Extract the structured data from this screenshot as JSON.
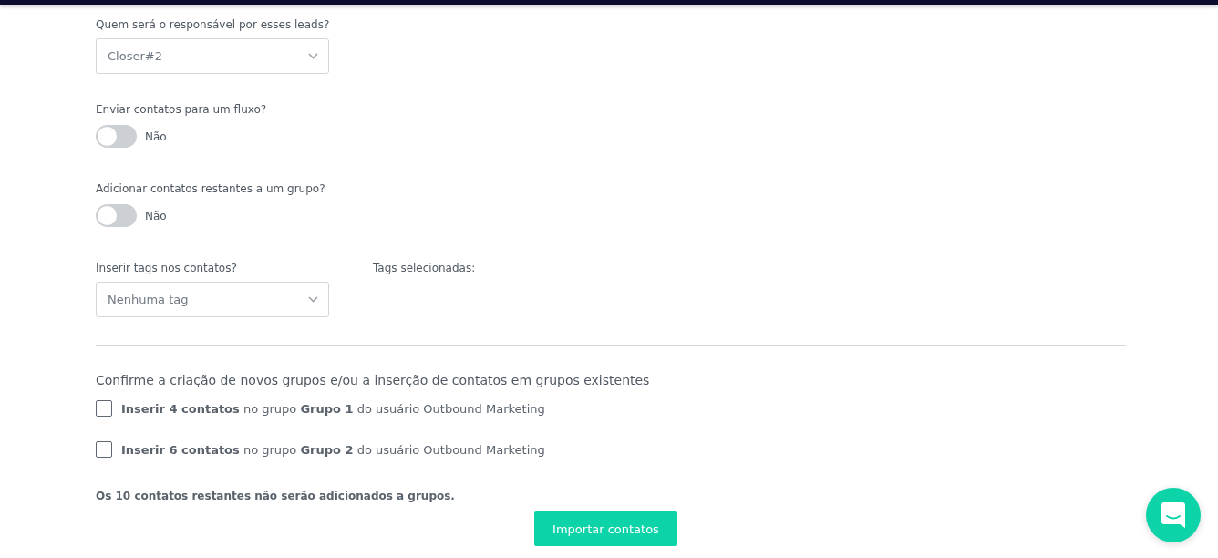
{
  "responsible": {
    "label": "Quem será o responsável por esses leads?",
    "value": "Closer#2"
  },
  "flow": {
    "label": "Enviar contatos para um fluxo?",
    "on": false,
    "state_label": "Não"
  },
  "group": {
    "label": "Adicionar contatos restantes a um grupo?",
    "on": false,
    "state_label": "Não"
  },
  "tags": {
    "label": "Inserir tags nos contatos?",
    "value": "Nenhuma tag",
    "selected_label": "Tags selecionadas:"
  },
  "confirm": {
    "heading": "Confirme a criação de novos grupos e/ou a inserção de contatos em grupos existentes",
    "items": [
      {
        "text": "**Inserir 4 contatos** no grupo **Grupo 1** do usuário Outbound Marketing",
        "checked": false
      },
      {
        "text": "**Inserir 6 contatos** no grupo **Grupo 2** do usuário Outbound Marketing",
        "checked": false
      }
    ]
  },
  "note": "Os 10 contatos restantes não serão adicionados a grupos.",
  "import_button": "Importar contatos"
}
